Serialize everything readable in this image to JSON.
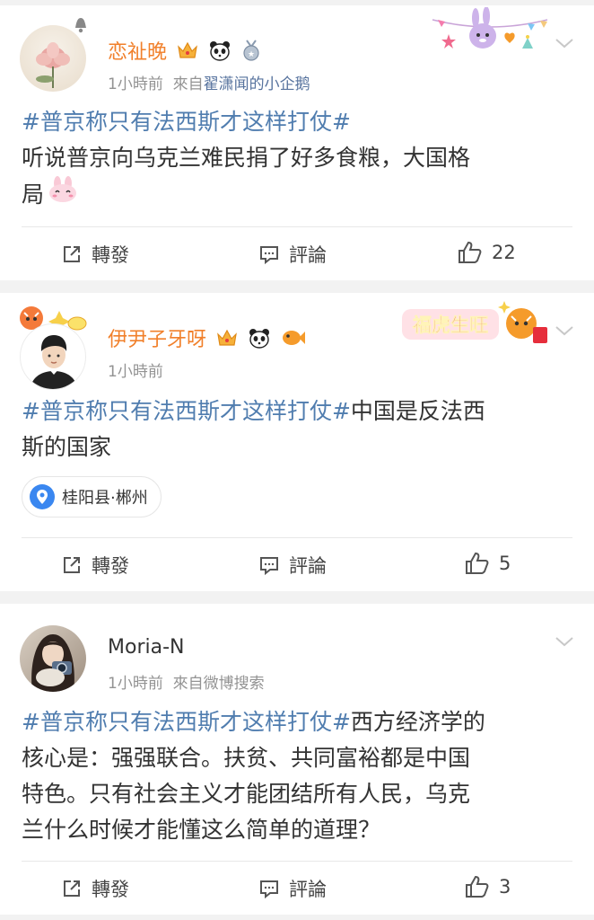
{
  "actions_labels": {
    "repost": "轉發",
    "comment": "評論"
  },
  "colors": {
    "vip_name": "#f1802b",
    "hashtag": "#507daf",
    "link": "#57739e",
    "meta": "#939393",
    "location_pin": "#3a87f0"
  },
  "posts": [
    {
      "username": "恋祉晚",
      "time": "1小時前",
      "source_prefix": "來自",
      "source": "翟潇闻的小企鹅",
      "hashtag": "#普京称只有法西斯才这样打仗#",
      "text_line1": "听说普京向乌克兰难民捐了好多食粮，大国格",
      "text_line2": "局",
      "likes": "22",
      "badges": [
        "crown-icon",
        "panda-icon",
        "medal-icon"
      ],
      "avatar": "lotus-avatar"
    },
    {
      "username": "伊尹子牙呀",
      "time": "1小時前",
      "hashtag": "#普京称只有法西斯才这样打仗#",
      "text_after_tag": "中国是反法西",
      "text_line2": "斯的国家",
      "location": "桂阳县·郴州",
      "likes": "5",
      "decoration_text": "福虎生旺",
      "badges": [
        "crown-icon",
        "panda-icon",
        "fish-icon"
      ],
      "avatar": "cartoon-man-avatar"
    },
    {
      "username": "Moria-N",
      "time": "1小時前",
      "source_prefix": "來自",
      "source": "微博搜索",
      "hashtag": "#普京称只有法西斯才这样打仗#",
      "text_after_tag": "西方经济学的",
      "text_line2": "核心是：强强联合。扶贫、共同富裕都是中国",
      "text_line3": "特色。只有社会主义才能团结所有人民，乌克",
      "text_line4": "兰什么时候才能懂这么简单的道理？",
      "likes": "3",
      "avatar": "photo-woman-camera"
    }
  ]
}
